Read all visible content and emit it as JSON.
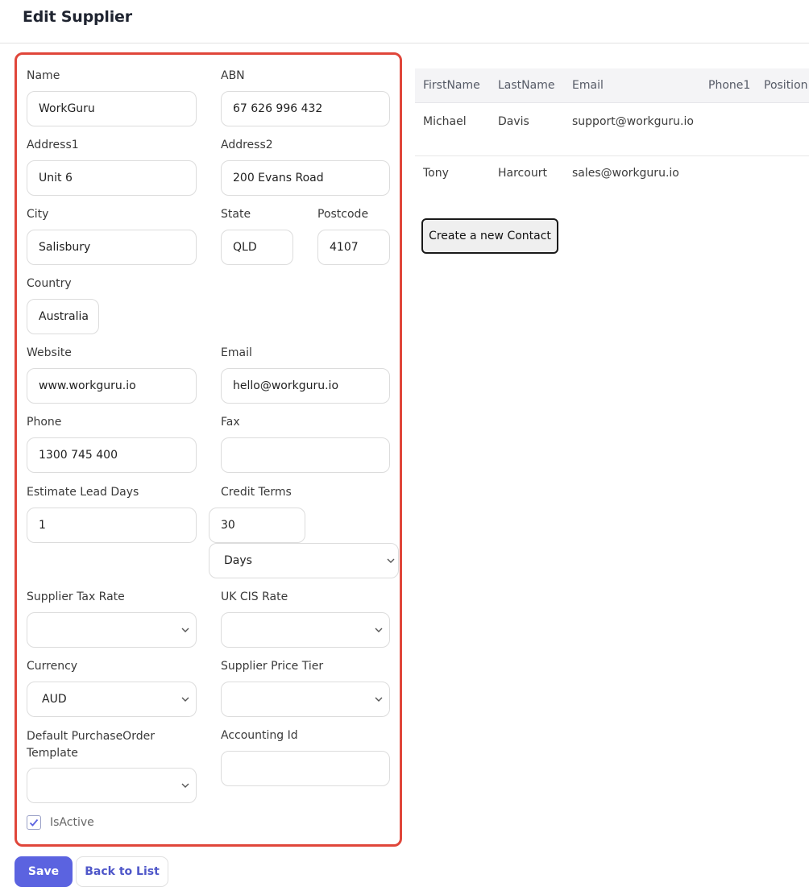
{
  "page": {
    "title": "Edit Supplier"
  },
  "form": {
    "name": {
      "label": "Name",
      "value": "WorkGuru"
    },
    "abn": {
      "label": "ABN",
      "value": "67 626 996 432"
    },
    "address1": {
      "label": "Address1",
      "value": "Unit 6"
    },
    "address2": {
      "label": "Address2",
      "value": "200 Evans Road"
    },
    "city": {
      "label": "City",
      "value": "Salisbury"
    },
    "state": {
      "label": "State",
      "value": "QLD"
    },
    "postcode": {
      "label": "Postcode",
      "value": "4107"
    },
    "country": {
      "label": "Country",
      "value": "Australia"
    },
    "website": {
      "label": "Website",
      "value": "www.workguru.io"
    },
    "email": {
      "label": "Email",
      "value": "hello@workguru.io"
    },
    "phone": {
      "label": "Phone",
      "value": "1300 745 400"
    },
    "fax": {
      "label": "Fax",
      "value": ""
    },
    "estimate_lead_days": {
      "label": "Estimate Lead Days",
      "value": "1"
    },
    "credit_terms": {
      "label": "Credit Terms",
      "value": "30",
      "unit": "Days"
    },
    "supplier_tax_rate": {
      "label": "Supplier Tax Rate",
      "value": ""
    },
    "uk_cis_rate": {
      "label": "UK CIS Rate",
      "value": ""
    },
    "currency": {
      "label": "Currency",
      "value": "AUD"
    },
    "supplier_price_tier": {
      "label": "Supplier Price Tier",
      "value": ""
    },
    "default_po_template": {
      "label": "Default PurchaseOrder Template",
      "value": ""
    },
    "accounting_id": {
      "label": "Accounting Id",
      "value": ""
    },
    "is_active": {
      "label": "IsActive",
      "checked": true
    }
  },
  "actions": {
    "save": "Save",
    "back": "Back to List"
  },
  "contacts": {
    "columns": [
      "FirstName",
      "LastName",
      "Email",
      "Phone1",
      "Position"
    ],
    "rows": [
      {
        "first": "Michael",
        "last": "Davis",
        "email": "support@workguru.io",
        "phone": "",
        "position": ""
      },
      {
        "first": "Tony",
        "last": "Harcourt",
        "email": "sales@workguru.io",
        "phone": "",
        "position": ""
      }
    ],
    "create_button": "Create a new Contact"
  },
  "colors": {
    "accent": "#5b63e0",
    "highlight_border": "#e0463a"
  }
}
